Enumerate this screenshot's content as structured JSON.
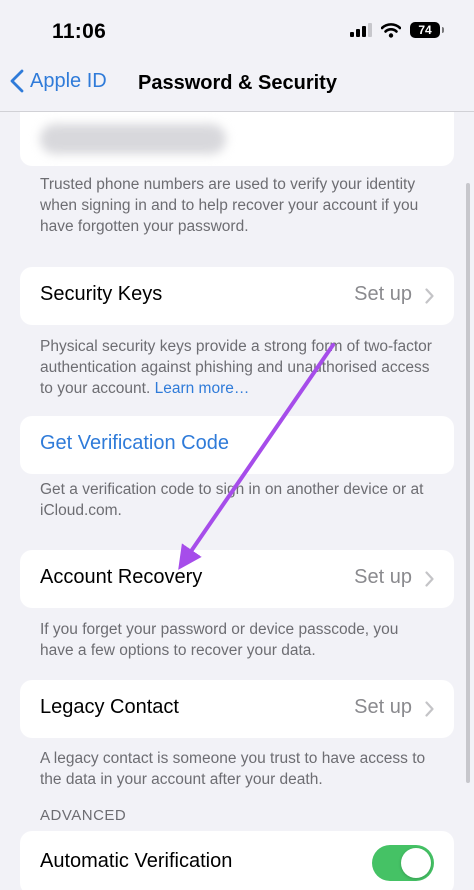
{
  "status_bar": {
    "time": "11:06",
    "battery": "74"
  },
  "nav": {
    "back_label": "Apple ID",
    "title": "Password & Security"
  },
  "trusted_numbers": {
    "footnote": "Trusted phone numbers are used to verify your identity when signing in and to help recover your account if you have forgotten your password."
  },
  "security_keys": {
    "label": "Security Keys",
    "value": "Set up",
    "footnote": "Physical security keys provide a strong form of two-factor authentication against phishing and unauthorised access to your account.",
    "link": "Learn more…"
  },
  "verification": {
    "label": "Get Verification Code",
    "footnote": "Get a verification code to sign in on another device or at iCloud.com."
  },
  "account_recovery": {
    "label": "Account Recovery",
    "value": "Set up",
    "footnote": "If you forget your password or device passcode, you have a few options to recover your data."
  },
  "legacy_contact": {
    "label": "Legacy Contact",
    "value": "Set up",
    "footnote": "A legacy contact is someone you trust to have access to the data in your account after your death."
  },
  "advanced": {
    "header": "ADVANCED",
    "auto_verification_label": "Automatic Verification",
    "auto_verification_on": true
  },
  "colors": {
    "accent": "#2f7bd9",
    "toggle_on": "#45c265",
    "annotation_arrow": "#a64dea"
  }
}
